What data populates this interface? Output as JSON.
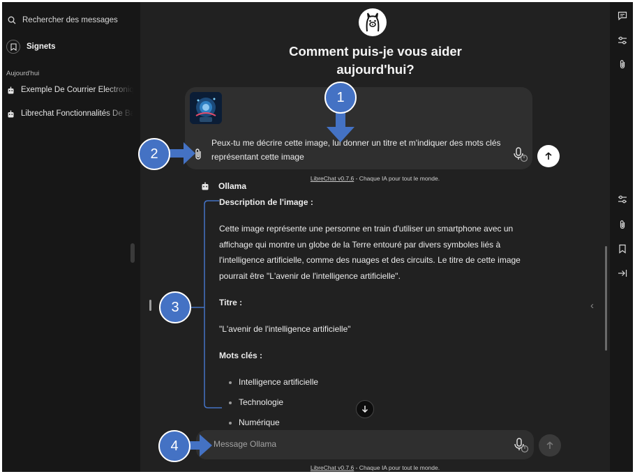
{
  "sidebar": {
    "search_label": "Rechercher des messages",
    "bookmarks_label": "Signets",
    "section_today": "Aujourd'hui",
    "conversations": [
      {
        "title": "Exemple De Courrier Electronique"
      },
      {
        "title": "Librechat Fonctionnalités De Base"
      }
    ]
  },
  "main": {
    "welcome_line1": "Comment puis-je vous aider",
    "welcome_line2": "aujourd'hui?",
    "prompt_text": "Peux-tu me décrire cette image, lui donner un titre et m'indiquer des mots clés représentant cette image",
    "footer_link": "LibreChat v0.7.6",
    "footer_text": " - Chaque IA pour tout le monde.",
    "bot_name": "Ollama",
    "response": {
      "desc_heading": "Description de l'image :",
      "desc_text": "Cette image représente une personne en train d'utiliser un smartphone avec un affichage qui montre un globe de la Terre entouré par divers symboles liés à l'intelligence artificielle, comme des nuages et des circuits. Le titre de cette image pourrait être \"L'avenir de l'intelligence artificielle\".",
      "title_heading": "Titre :",
      "title_text": "\"L'avenir de l'intelligence artificielle\"",
      "keywords_heading": "Mots clés :",
      "keywords": [
        "Intelligence artificielle",
        "Technologie",
        "Numérique"
      ]
    },
    "message_placeholder": "Message Ollama"
  },
  "annotations": [
    "1",
    "2",
    "3",
    "4"
  ],
  "colors": {
    "background": "#212121",
    "sidebar": "#171717",
    "input": "#2f2f2f",
    "annotation": "#4472c4"
  },
  "icons": [
    "search-icon",
    "bookmark-icon",
    "robot-icon",
    "llama-icon",
    "paperclip-icon",
    "mic-icon",
    "arrow-up-icon",
    "arrow-down-icon",
    "chat-icon",
    "sliders-icon",
    "arrow-right-bar-icon"
  ]
}
